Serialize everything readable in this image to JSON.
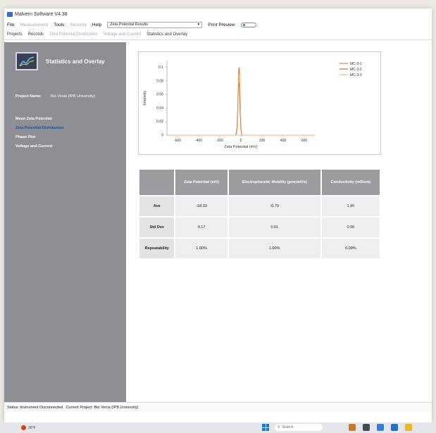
{
  "window": {
    "title": "Malvern Software V4.38"
  },
  "menubar": {
    "items": [
      {
        "label": "File",
        "dim": false
      },
      {
        "label": "Measurement",
        "dim": true
      },
      {
        "label": "Tools",
        "dim": false
      },
      {
        "label": "Security",
        "dim": true
      },
      {
        "label": "Help",
        "dim": false
      }
    ],
    "combo_value": "Zeta Potential Results",
    "print_preview_label": "Print Preview"
  },
  "tabs": [
    {
      "label": "Projects",
      "dim": false
    },
    {
      "label": "Records",
      "dim": false
    },
    {
      "label": "Zeta Potential Distribution",
      "dim": true
    },
    {
      "label": "Voltage and Current",
      "dim": true
    },
    {
      "label": "Statistics and Overlay",
      "dim": false
    }
  ],
  "sidebar": {
    "title": "Statistics and Overlay",
    "project_label": "Project Name:",
    "project_value": "Bio Venia (IPB University)",
    "nav": [
      {
        "label": "Mean Zeta Potential",
        "active": false
      },
      {
        "label": "Zeta Potential Distribution",
        "active": true
      },
      {
        "label": "Phase Plot",
        "active": false
      },
      {
        "label": "Voltage and Current",
        "active": false
      }
    ]
  },
  "chart_data": {
    "type": "line",
    "xlabel": "Zeta Potential (mV)",
    "ylabel": "Intensity",
    "xlim": [
      -700,
      700
    ],
    "ylim": [
      0,
      0.11
    ],
    "xticks": [
      -600,
      -400,
      -200,
      0,
      200,
      400,
      600
    ],
    "yticks": [
      0,
      0.02,
      0.04,
      0.06,
      0.08,
      0.1
    ],
    "ytick_labels": [
      "0",
      "0.02",
      "0.04",
      "0.06",
      "0.08",
      "0.1"
    ],
    "series": [
      {
        "name": "MC-3-1",
        "color": "#e06a1f",
        "mean": -17,
        "sd": 9,
        "peak": 0.1
      },
      {
        "name": "MC-3-2",
        "color": "#a8581e",
        "mean": -19,
        "sd": 9.5,
        "peak": 0.078
      },
      {
        "name": "MC-3-3",
        "color": "#f3b37a",
        "mean": -16,
        "sd": 9,
        "peak": 0.09
      }
    ],
    "legend": "top-right",
    "grid": false
  },
  "table": {
    "headers": [
      "",
      "Zeta Potential (mV)",
      "Electrophoretic Mobility (µmcm/Vs)",
      "Conductivity (mS/cm)"
    ],
    "rows": [
      [
        "Ave",
        "-18.33",
        "-0.79",
        "1.90"
      ],
      [
        "Std Dev",
        "0.17",
        "0.01",
        "0.00"
      ],
      [
        "Repeatability",
        "1.00%",
        "1.00%",
        "0.00%"
      ]
    ]
  },
  "status": {
    "text": "Status: Instrument Disconnected",
    "project": "Current Project: Bio Venia (IPB University)"
  },
  "taskbar": {
    "weather_temp": "26°F",
    "search_placeholder": "Search",
    "app_colors": [
      "#c47a2c",
      "#444a55",
      "#3a7bd5",
      "#2a6cc9",
      "#e9b82d"
    ]
  }
}
